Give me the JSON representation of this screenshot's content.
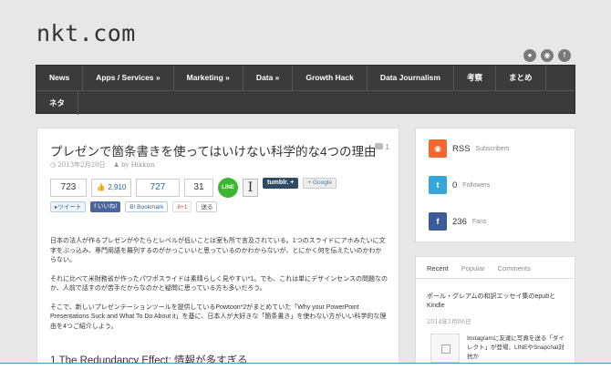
{
  "site": {
    "title": "nkt.com"
  },
  "social_icons": [
    "circle-icon",
    "rss-icon",
    "facebook-icon"
  ],
  "nav": {
    "row1": [
      "News",
      "Apps / Services »",
      "Marketing »",
      "Data »",
      "Growth Hack",
      "Data Journalism",
      "考察",
      "まとめ"
    ],
    "row2": [
      "ネタ"
    ]
  },
  "post": {
    "title": "プレゼンで箇条書きを使ってはいけない科学的な4つの理由",
    "comments": "1",
    "date": "2013年2月20日",
    "author": "by Hikkun",
    "share": {
      "count1": "723",
      "hatena_count": "2,910",
      "count2": "727",
      "count3": "31",
      "line_label": "LINE",
      "i_label": "I",
      "tumblr_label": "tumblr. +",
      "google_label": "Google",
      "tweet_label": "ツイート",
      "fb_label": "いいね!",
      "hb_label": "Bookmark",
      "gplus_label": "8+1",
      "send_label": "送る"
    },
    "paragraphs": [
      "日本の法人が作るプレゼンがやたらとレベルが低いことは室も所で言及されている。1つのスライドにアホみたいに文字をぶっ込み、専門用語を羅列するのがかっこいいと思っているのかわからないが、とにかく何を伝えたいのかわからない。",
      "それに比べて米財務省が作ったパワポスライドは素晴らしく見やすい*1。でも、これは単にデザインセンスの問題なのか、人前で話すのが苦手だからなのかと疑問に思っている方も多いだろう。",
      "そこで、新しいプレゼンテーションツールを提供しているPowtoon*2がまとめていた「Why your PowerPoint Presentations Suck and What To Do About it」を基に、日本人が大好きな「箇条書き」を使わない方がいい科学的な理由を4つご紹介しよう。"
    ],
    "section_heading": "1.The Redundancy Effect: 情報が多すぎる"
  },
  "sidebar": {
    "rss": {
      "icon": "rss-icon",
      "value": "RSS",
      "label": "Subscribers"
    },
    "twitter": {
      "icon": "twitter-icon",
      "value": "0",
      "label": "Followers"
    },
    "facebook": {
      "icon": "facebook-icon",
      "value": "236",
      "label": "Fans"
    },
    "tabs": [
      "Recent",
      "Popular",
      "Comments"
    ],
    "recent": {
      "title": "ポール・グレアムの和訳エッセイ集のepubとKindle",
      "date": "2014年1月06日",
      "item2": "Instagramに友達に写真を送る「ダイレクト」が登場、LINEやSnapchat対抗か"
    }
  },
  "colors": {
    "nav_bg": "#3b3b3b",
    "rss": "#f2692f",
    "twitter": "#36a5d8",
    "facebook": "#3b5b98",
    "line": "#3bb631"
  }
}
